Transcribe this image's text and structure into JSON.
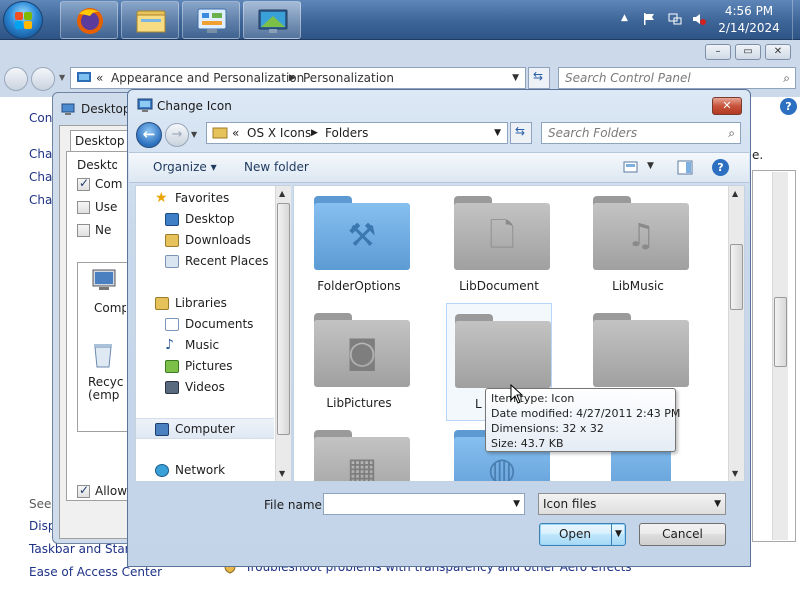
{
  "taskbar": {
    "clock_time": "4:56 PM",
    "clock_date": "2/14/2024",
    "buttons": [
      "firefox",
      "file-explorer",
      "control-panel",
      "display-settings"
    ]
  },
  "control_panel": {
    "breadcrumb_prefix": "«",
    "breadcrumb": [
      "Appearance and Personalization",
      "Personalization"
    ],
    "search_placeholder": "Search Control Panel",
    "left_items": [
      "Con",
      "Cha",
      "Cha",
      "Cha"
    ],
    "see_also": "See",
    "bottom_links": [
      "Disp",
      "Taskbar and Start",
      "Ease of Access Center"
    ],
    "footer_link": "Troubleshoot problems with transparency and other Aero effects",
    "right_fragment": "e."
  },
  "desktop_icon_settings": {
    "title": "Desktop",
    "tab": "Desktop Ico",
    "group_label": "Desktop",
    "checkboxes": [
      {
        "label": "Com",
        "checked": true
      },
      {
        "label": "Use",
        "checked": false
      },
      {
        "label": "Ne",
        "checked": false
      }
    ],
    "icons": [
      {
        "label": "Comp"
      },
      {
        "label": "Recyc\n(emp"
      }
    ],
    "allow_label": "Allow",
    "allow_checked": true
  },
  "change_icon": {
    "title": "Change Icon",
    "close_label": "✕",
    "address_prefix": "«",
    "address": [
      "OS X Icons",
      "Folders"
    ],
    "search_placeholder": "Search Folders",
    "toolbar": {
      "organize": "Organize ▾",
      "new_folder": "New folder"
    },
    "nav": {
      "favorites": "Favorites",
      "favorite_items": [
        "Desktop",
        "Downloads",
        "Recent Places"
      ],
      "libraries": "Libraries",
      "library_items": [
        "Documents",
        "Music",
        "Pictures",
        "Videos"
      ],
      "computer": "Computer",
      "network": "Network"
    },
    "files": [
      {
        "name": "FolderOptions",
        "glyph": "hammer-icon"
      },
      {
        "name": "LibDocument",
        "glyph": "document-icon"
      },
      {
        "name": "LibMusic",
        "glyph": "music-note-icon"
      },
      {
        "name": "LibPictures",
        "glyph": "camera-icon"
      },
      {
        "name": "L",
        "glyph": "blank-folder-icon"
      },
      {
        "name": "",
        "glyph": "blank-folder-icon"
      },
      {
        "name": "",
        "glyph": "film-icon"
      },
      {
        "name": "",
        "glyph": "globe-icon"
      },
      {
        "name": "",
        "glyph": "blank-folder-icon"
      }
    ],
    "tooltip": {
      "item_type": "Item type: Icon",
      "date_modified": "Date modified: 4/27/2011 2:43 PM",
      "dimensions": "Dimensions: 32 x 32",
      "size": "Size: 43.7 KB"
    },
    "file_name_label": "File name:",
    "file_name_value": "",
    "file_type": "Icon files",
    "open_label": "Open",
    "cancel_label": "Cancel"
  },
  "colors": {
    "taskbar": "#3e6597",
    "dialog_chrome": "#c9d9ec",
    "folder_gray": "#a3a3a3",
    "folder_blue": "#6aa7dc",
    "link": "#1e3287"
  }
}
